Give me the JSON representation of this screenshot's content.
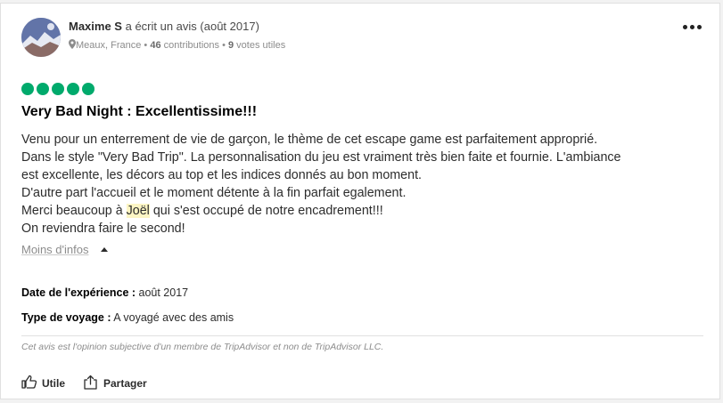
{
  "review": {
    "author": "Maxime S",
    "action_text": " a écrit un avis (août 2017)",
    "location": "Meaux, France",
    "contributions_count": "46",
    "contributions_label": " contributions",
    "separator": " • ",
    "votes_count": "9",
    "votes_label": " votes utiles",
    "rating": 5,
    "rating_color": "#00aa6c",
    "title": "Very Bad Night : Excellentissime!!!",
    "body": {
      "line1": "Venu pour un enterrement de vie de garçon, le thème de cet escape game est parfaitement approprié.",
      "line2": "Dans le style \"Very Bad Trip\". La personnalisation du jeu est vraiment très bien faite et fournie. L'ambiance",
      "line3": "est excellente, les décors au top et les indices donnés au bon moment.",
      "line4": "D'autre part l'accueil et le moment détente à la fin parfait egalement.",
      "line5_before": "Merci beaucoup à ",
      "line5_highlight": "Joël",
      "line5_after": " qui s'est occupé de notre encadrement!!!",
      "line6": "On reviendra faire le second!"
    },
    "less_link": "Moins d'infos",
    "experience_date_label": "Date de l'expérience :",
    "experience_date_value": " août 2017",
    "trip_type_label": "Type de voyage :",
    "trip_type_value": " A voyagé avec des amis",
    "disclaimer": "Cet avis est l'opinion subjective d'un membre de TripAdvisor et non de TripAdvisor LLC.",
    "helpful_label": "Utile",
    "share_label": "Partager"
  },
  "icons": {
    "more": "more-options-icon",
    "location": "map-pin-icon",
    "helpful": "thumbs-up-icon",
    "share": "share-icon",
    "collapse": "caret-up-icon"
  }
}
